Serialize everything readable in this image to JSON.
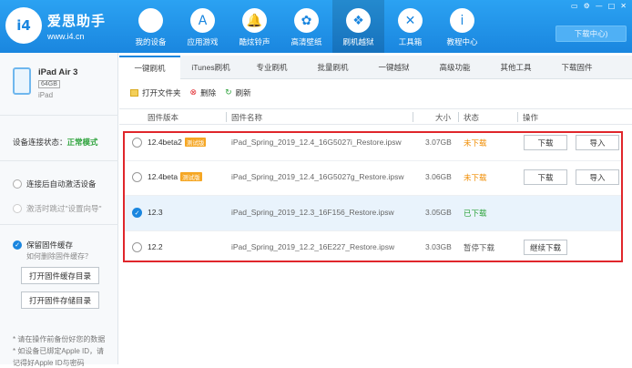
{
  "header": {
    "logo_mark": "i4",
    "logo_title": "爱思助手",
    "logo_url": "www.i4.cn",
    "nav": [
      {
        "label": "我的设备",
        "icon": "apple-icon",
        "glyph": ""
      },
      {
        "label": "应用游戏",
        "icon": "app-store-icon",
        "glyph": "A"
      },
      {
        "label": "酷炫铃声",
        "icon": "bell-icon",
        "glyph": "🔔"
      },
      {
        "label": "高清壁纸",
        "icon": "flower-icon",
        "glyph": "✿"
      },
      {
        "label": "刷机越狱",
        "icon": "dropbox-icon",
        "glyph": "❖"
      },
      {
        "label": "工具箱",
        "icon": "tools-icon",
        "glyph": "✕"
      },
      {
        "label": "教程中心",
        "icon": "info-icon",
        "glyph": "i"
      }
    ],
    "active_nav": 4,
    "window_controls": [
      "▭",
      "⚙",
      "—",
      "□",
      "✕"
    ],
    "download_center": "下载中心)"
  },
  "sidebar": {
    "device_name": "iPad Air 3",
    "capacity": "64GB",
    "device_type": "iPad",
    "connection_label": "设备连接状态：",
    "connection_value": "正常模式",
    "option1": "连接后自动激活设备",
    "option2": "激活时跳过\"设置向导\"",
    "keep_cache": "保留固件缓存",
    "keep_cache_sub": "如何删除固件缓存？",
    "btn_open_cache": "打开固件缓存目录",
    "btn_open_store": "打开固件存储目录",
    "note1": "* 请在操作前备份好您的数据",
    "note2": "* 如设备已绑定Apple ID，请",
    "note3": "记得好Apple ID与密码"
  },
  "tabs": [
    "一键刷机",
    "iTunes刷机",
    "专业刷机",
    "批量刷机",
    "一键越狱",
    "高级功能",
    "其他工具",
    "下载固件"
  ],
  "active_tab": 0,
  "toolbar": {
    "open_folder": "打开文件夹",
    "delete": "删除",
    "refresh": "刷新"
  },
  "table": {
    "headers": {
      "version": "固件版本",
      "name": "固件名称",
      "size": "大小",
      "status": "状态",
      "actions": "操作"
    },
    "rows": [
      {
        "version": "12.4beta2",
        "badge": "测试版",
        "name": "iPad_Spring_2019_12.4_16G5027i_Restore.ipsw",
        "size": "3.07GB",
        "status": "未下载",
        "status_color": "#f08c00",
        "btn1": "下载",
        "btn2": "导入",
        "selected": false
      },
      {
        "version": "12.4beta",
        "badge": "测试版",
        "name": "iPad_Spring_2019_12.4_16G5027g_Restore.ipsw",
        "size": "3.06GB",
        "status": "未下载",
        "status_color": "#f08c00",
        "btn1": "下载",
        "btn2": "导入",
        "selected": false
      },
      {
        "version": "12.3",
        "badge": "",
        "name": "iPad_Spring_2019_12.3_16F156_Restore.ipsw",
        "size": "3.05GB",
        "status": "已下载",
        "status_color": "#2ea33c",
        "btn1": "",
        "btn2": "",
        "selected": true
      },
      {
        "version": "12.2",
        "badge": "",
        "name": "iPad_Spring_2019_12.2_16E227_Restore.ipsw",
        "size": "3.03GB",
        "status": "暂停下载",
        "status_color": "#555555",
        "btn1": "继续下载",
        "btn2": "",
        "selected": false
      }
    ]
  },
  "colors": {
    "accent": "#1a86df",
    "highlight_border": "#e0262b",
    "badge": "#f5a623"
  }
}
